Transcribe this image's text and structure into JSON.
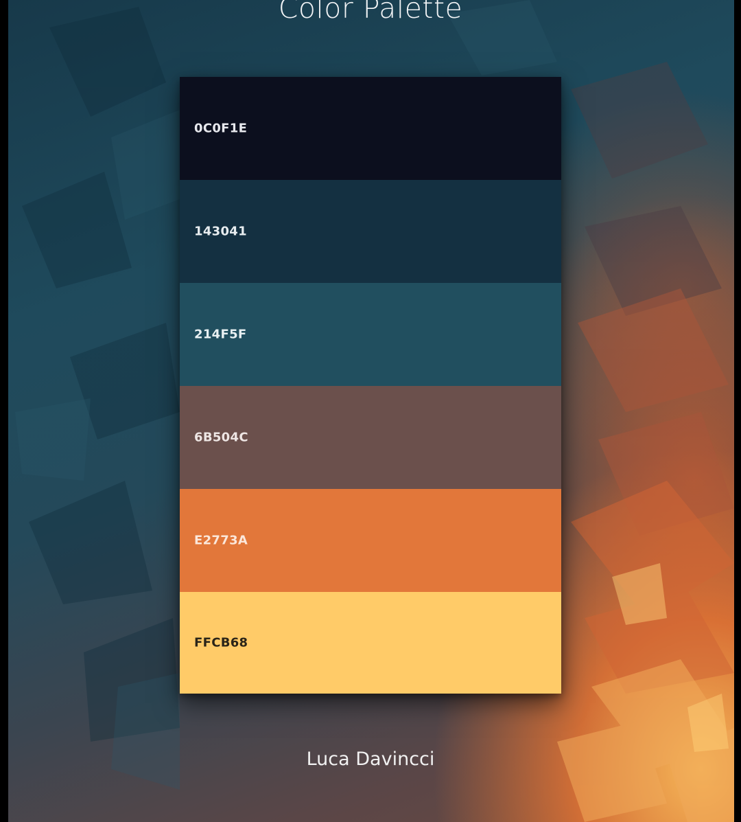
{
  "title": "Color Palette",
  "author": "Luca Davincci",
  "swatches": [
    {
      "label": "0C0F1E",
      "color": "#0c0f1e",
      "text_color": "#e8e9ee"
    },
    {
      "label": "143041",
      "color": "#143041",
      "text_color": "#e8edf0"
    },
    {
      "label": "214F5F",
      "color": "#214f5f",
      "text_color": "#e8f0f2"
    },
    {
      "label": "6B504C",
      "color": "#6b504c",
      "text_color": "#eee6e4"
    },
    {
      "label": "E2773A",
      "color": "#e2773a",
      "text_color": "#fbe7da"
    },
    {
      "label": "FFCB68",
      "color": "#ffcb68",
      "text_color": "#2a2418"
    }
  ]
}
